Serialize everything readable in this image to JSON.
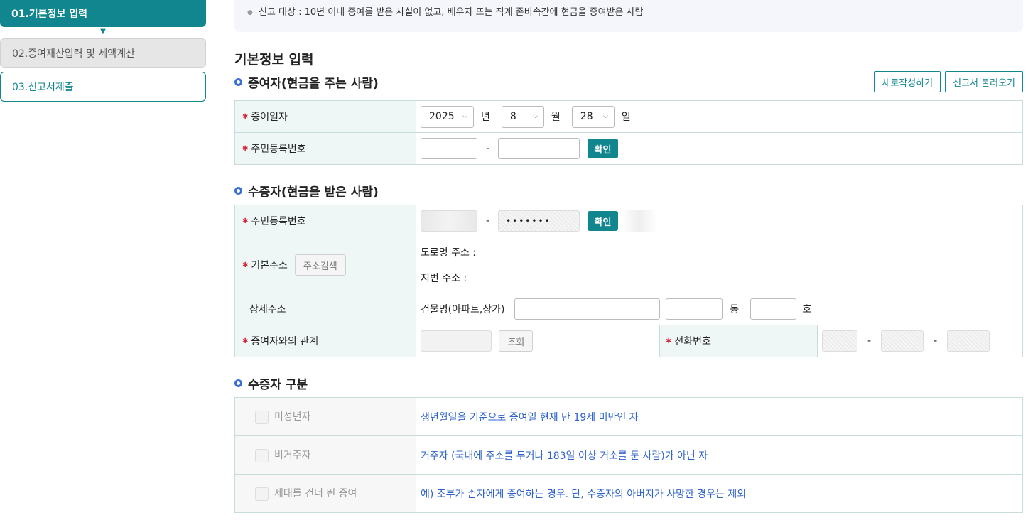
{
  "sidebar": {
    "steps": [
      {
        "label": "01.기본정보 입력"
      },
      {
        "label": "02.증여재산입력 및 세액계산"
      },
      {
        "label": "03.신고서제출"
      }
    ]
  },
  "notice": {
    "text": "신고 대상 : 10년 이내 증여를 받은 사실이 없고, 배우자 또는 직계 존비속간에 현금을 증여받은 사람"
  },
  "page_title": "기본정보 입력",
  "donor": {
    "title": "증여자(현금을 주는 사람)",
    "new_button": "새로작성하기",
    "load_button": "신고서 불러오기",
    "date_label": "증여일자",
    "year": "2025",
    "year_unit": "년",
    "month": "8",
    "month_unit": "월",
    "day": "28",
    "day_unit": "일",
    "rrn_label": "주민등록번호",
    "dash": "-",
    "confirm": "확인"
  },
  "donee": {
    "title": "수증자(현금을 받은 사람)",
    "rrn_label": "주민등록번호",
    "dash": "-",
    "rrn_masked": "•••••••",
    "confirm": "확인",
    "address_label": "기본주소",
    "address_search": "주소검색",
    "road_address": "도로명 주소 :",
    "lot_address": "지번 주소 :",
    "detail_label": "상세주소",
    "building_label": "건물명(아파트,상가)",
    "dong": "동",
    "ho": "호",
    "relation_label": "증여자와의 관계",
    "lookup": "조회",
    "phone_label": "전화번호",
    "phone_dash": "-"
  },
  "category": {
    "title": "수증자 구분",
    "rows": [
      {
        "label": "미성년자",
        "desc": "생년월일을 기준으로 증여일 현재 만 19세 미만인 자"
      },
      {
        "label": "비거주자",
        "desc": "거주자 (국내에 주소를 두거나 183일 이상 거소를 둔 사람)가 아닌 자"
      },
      {
        "label": "세대를 건너 뛴 증여",
        "desc": "예) 조부가 손자에게 증여하는 경우. 단, 수증자의 아버지가 사망한 경우는 제외"
      }
    ]
  }
}
